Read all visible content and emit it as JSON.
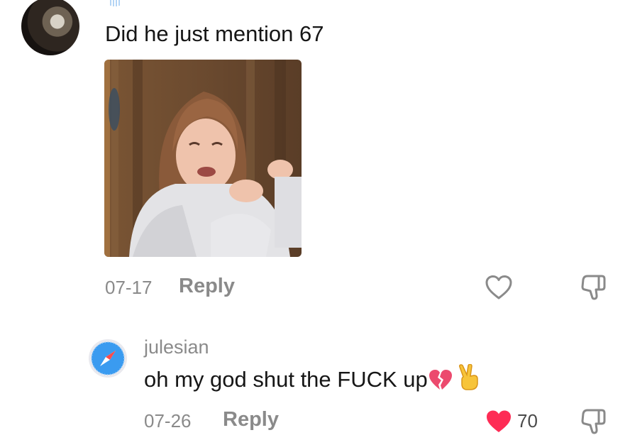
{
  "comment": {
    "text": "Did he just mention 67",
    "date": "07-17",
    "reply_label": "Reply"
  },
  "reply": {
    "username": "julesian",
    "text": "oh my god shut the FUCK up",
    "date": "07-26",
    "reply_label": "Reply",
    "like_count": "70"
  },
  "colors": {
    "text": "#161616",
    "meta": "#8a8a8a",
    "liked_heart": "#fe2c55"
  }
}
